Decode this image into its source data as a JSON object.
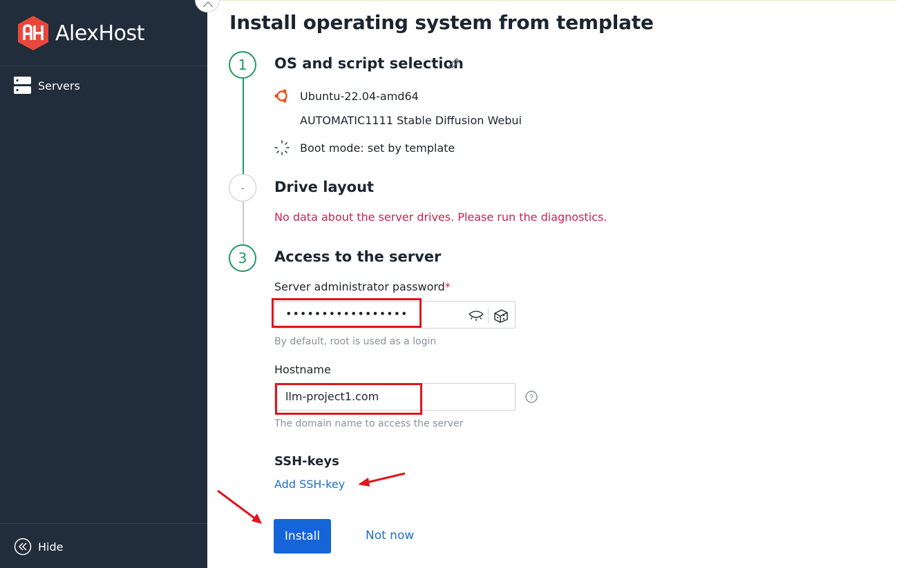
{
  "sidebar": {
    "brand_text": "AlexHost",
    "nav_items": [
      {
        "label": "Servers",
        "icon": "server-icon"
      }
    ],
    "hide_label": "Hide"
  },
  "main": {
    "title": "Install operating system from template",
    "steps": [
      {
        "number": "1",
        "title": "OS and script selection"
      },
      {
        "number": "-",
        "title": "Drive layout"
      },
      {
        "number": "3",
        "title": "Access to the server"
      }
    ],
    "os": {
      "image": "Ubuntu-22.04-amd64",
      "script": "AUTOMATIC1111 Stable Diffusion Webui",
      "boot_mode": "Boot mode: set by template"
    },
    "drive_error": "No data about the server drives. Please run the diagnostics.",
    "access": {
      "password_label": "Server administrator password",
      "password_required_mark": "*",
      "password_value": "•••••••••••••••••",
      "password_hint": "By default, root is used as a login",
      "hostname_label": "Hostname",
      "hostname_value": "llm-project1.com",
      "hostname_hint": "The domain name to access the server",
      "ssh_title": "SSH-keys",
      "ssh_add_label": "Add SSH-key"
    },
    "actions": {
      "install": "Install",
      "not_now": "Not now"
    }
  },
  "colors": {
    "sidebar_bg": "#222d3b",
    "accent_green": "#1d9b5f",
    "error_red": "#cc1f4a",
    "primary_blue": "#1565d8",
    "link_blue": "#1c6fc9",
    "brand_red": "#e8483c",
    "annotation_red": "#e0141b"
  }
}
